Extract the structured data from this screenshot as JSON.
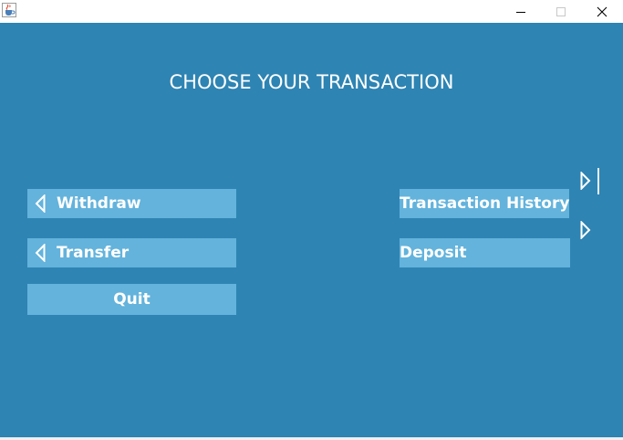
{
  "window": {
    "icon": "java-cup-icon",
    "controls": {
      "minimize": "minimize-icon",
      "maximize": "maximize-icon",
      "close": "close-icon"
    }
  },
  "heading": "CHOOSE YOUR TRANSACTION",
  "buttons": {
    "withdraw": "Withdraw",
    "transfer": "Transfer",
    "quit": "Quit",
    "history": "Transaction History",
    "deposit": "Deposit"
  },
  "colors": {
    "panel_background": "#2e84b3",
    "button_background": "#63b3dc",
    "text": "#ffffff"
  }
}
